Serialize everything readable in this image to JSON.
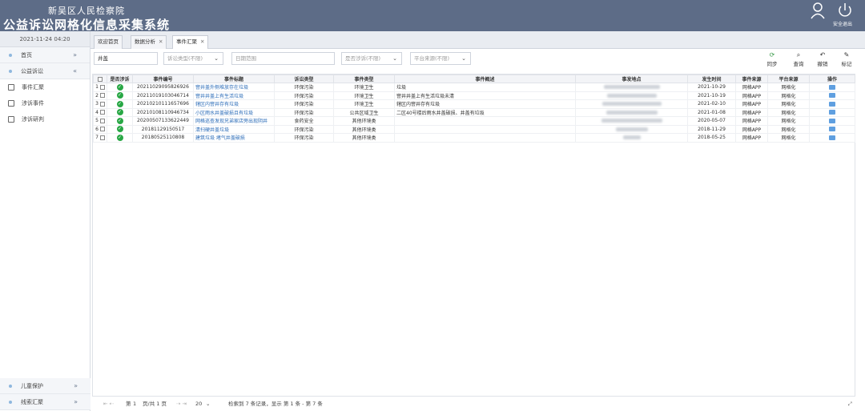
{
  "header": {
    "org": "新吴区人民检察院",
    "system": "公益诉讼网格化信息采集系统",
    "logout_label": "安全退出"
  },
  "sidebar": {
    "date": "2021-11-24 04:20",
    "items": [
      {
        "label": "首页",
        "chevron": "»"
      },
      {
        "label": "公益诉讼",
        "chevron": "«"
      }
    ],
    "subitems": [
      {
        "label": "事件汇聚",
        "icon": "table-icon"
      },
      {
        "label": "涉诉事件",
        "icon": "document-icon"
      },
      {
        "label": "涉诉研判",
        "icon": "chart-icon"
      }
    ],
    "bottom": [
      {
        "label": "儿童保护",
        "chevron": "»"
      },
      {
        "label": "线索汇聚",
        "chevron": "»"
      }
    ]
  },
  "tabs": [
    {
      "label": "欢迎首页",
      "closable": false
    },
    {
      "label": "数据分析",
      "closable": true
    },
    {
      "label": "事件汇聚",
      "closable": true
    }
  ],
  "filters": {
    "keyword": "井盖",
    "type_placeholder": "诉讼类型(不限)",
    "date_placeholder": "日期范围",
    "involved_placeholder": "是否涉诉(不限)",
    "source_placeholder": "平台来源(不限)"
  },
  "toolbar": {
    "sync": "同步",
    "query": "查询",
    "revoke": "撤销",
    "mark": "标记"
  },
  "table": {
    "headers": [
      "",
      "是否涉诉",
      "事件编号",
      "事件标题",
      "诉讼类型",
      "事件类型",
      "事件概述",
      "事发地点",
      "发生时间",
      "事件来源",
      "平台来源",
      "操作"
    ],
    "rows": [
      {
        "no": "1",
        "id": "20211029095826926",
        "title": "窨井盖外侧堆放存在垃圾",
        "ltype": "环保污染",
        "etype": "环境卫生",
        "summary": "垃圾",
        "time": "2021-10-29",
        "src": "网格APP",
        "plat": "网格化"
      },
      {
        "no": "2",
        "id": "20211019103046714",
        "title": "窨井井盖上有生活垃圾",
        "ltype": "环保污染",
        "etype": "环境卫生",
        "summary": "窨井井盖上有生活垃圾未清",
        "time": "2021-10-19",
        "src": "网格APP",
        "plat": "网格化"
      },
      {
        "no": "3",
        "id": "20210210111657696",
        "title": "辖区内窨井存有垃圾",
        "ltype": "环保污染",
        "etype": "环境卫生",
        "summary": "辖区内窨井存有垃圾",
        "time": "2021-02-10",
        "src": "网格APP",
        "plat": "网格化"
      },
      {
        "no": "4",
        "id": "20210108110946734",
        "title": "小区雨水井盖破损且有垃圾",
        "ltype": "环保污染",
        "etype": "公共区域卫生",
        "summary": "二区40号楼后雨水井盖破损、井盖有垃圾",
        "time": "2021-01-08",
        "src": "网格APP",
        "plat": "网格化"
      },
      {
        "no": "5",
        "id": "20200507133622449",
        "title": "网格巡查发现兄弟家店旁出现阴井",
        "ltype": "食药安全",
        "etype": "其他环境类",
        "summary": "",
        "time": "2020-05-07",
        "src": "网格APP",
        "plat": "网格化"
      },
      {
        "no": "6",
        "id": "20181129150517",
        "title": "清扫硬井盖垃圾",
        "ltype": "环保污染",
        "etype": "其他环境类",
        "summary": "",
        "time": "2018-11-29",
        "src": "网格APP",
        "plat": "网格化"
      },
      {
        "no": "7",
        "id": "20180525110808",
        "title": "建筑垃圾 堵气井盖破损",
        "ltype": "环保污染",
        "etype": "其他环境类",
        "summary": "",
        "time": "2018-05-25",
        "src": "网格APP",
        "plat": "网格化"
      }
    ]
  },
  "pager": {
    "page_label": "第",
    "page_value": "1",
    "total_label": "页/共 1 页",
    "size": "20",
    "info": "检索到 7 条记录，显示 第 1 条 - 第 7 条"
  },
  "colors": {
    "header": "#5d6c87",
    "link": "#2b6cb8",
    "ok": "#28a745"
  }
}
